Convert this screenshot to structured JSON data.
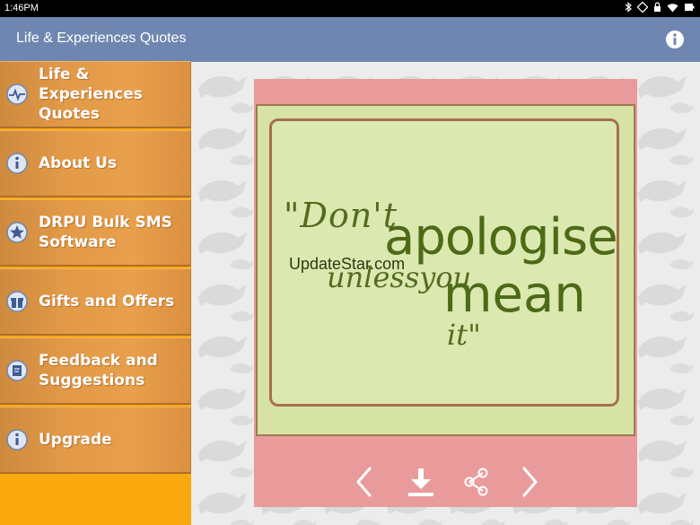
{
  "status_bar": {
    "time": "1:46PM"
  },
  "app_bar": {
    "title": "Life & Experiences Quotes",
    "info_icon": "info-icon"
  },
  "drawer": {
    "items": [
      {
        "label": "Life & Experiences Quotes",
        "icon": "pulse-icon"
      },
      {
        "label": "About Us",
        "icon": "info-icon"
      },
      {
        "label": "DRPU Bulk SMS Software",
        "icon": "star-icon"
      },
      {
        "label": "Gifts and Offers",
        "icon": "gift-icon"
      },
      {
        "label": "Feedback and Suggestions",
        "icon": "feedback-icon"
      },
      {
        "label": "Upgrade",
        "icon": "info-icon"
      }
    ]
  },
  "quote": {
    "line1": "\"Don't",
    "line2": "apologise",
    "line3": "unlessyou",
    "line4": "mean",
    "line5": "it\""
  },
  "watermark": "UpdateStar.com",
  "controls": {
    "prev": "chevron-left-icon",
    "download": "download-icon",
    "share": "share-icon",
    "next": "chevron-right-icon"
  },
  "colors": {
    "app_bar": "#6f87b0",
    "drawer": "#f9a80d",
    "card_border": "#e99b9b",
    "quote_background": "#dbe8b0",
    "quote_text": "#4d6a17"
  }
}
